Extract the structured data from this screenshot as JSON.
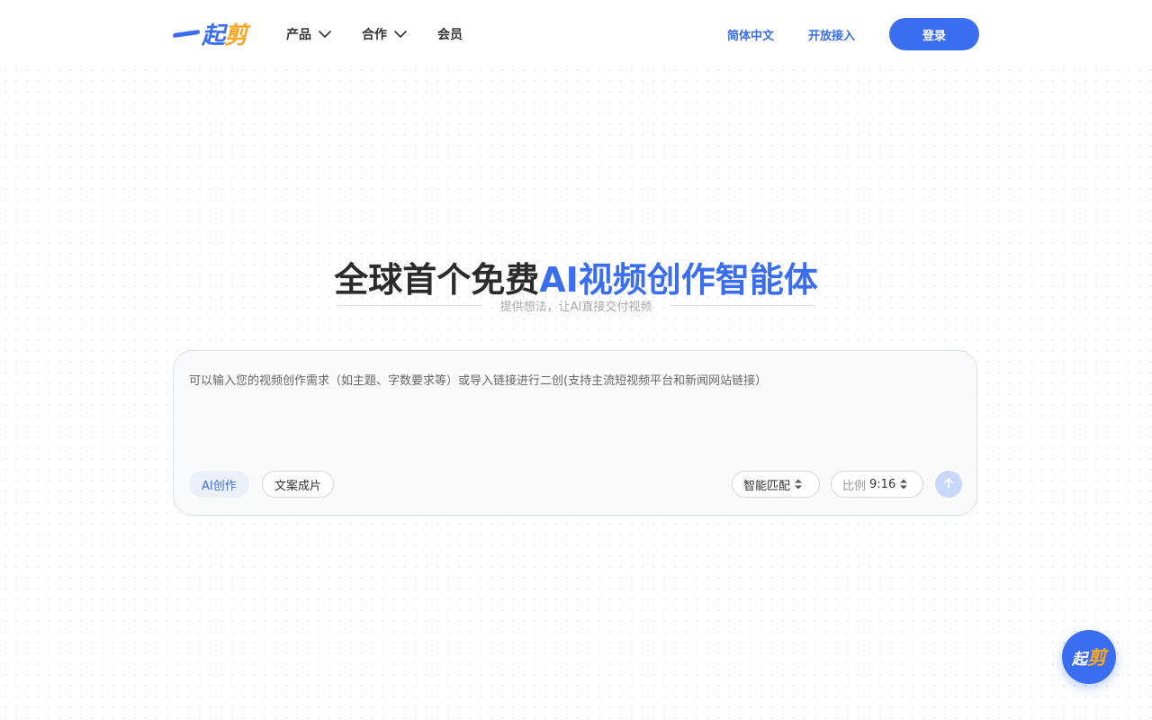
{
  "header": {
    "logo": {
      "part1": "起",
      "part2": "剪"
    },
    "nav": [
      {
        "label": "产品",
        "has_dropdown": true
      },
      {
        "label": "合作",
        "has_dropdown": true
      },
      {
        "label": "会员",
        "has_dropdown": false
      }
    ],
    "language_link": "简体中文",
    "open_access_link": "开放接入",
    "login_label": "登录"
  },
  "hero": {
    "title_plain": "全球首个免费",
    "title_accent": "AI视频创作智能体",
    "subtitle": "提供想法，让AI直接交付视频"
  },
  "prompt": {
    "placeholder": "可以输入您的视频创作需求（如主题、字数要求等）或导入链接进行二创(支持主流短视频平台和新闻网站链接）",
    "modes": [
      {
        "label": "AI创作",
        "active": true
      },
      {
        "label": "文案成片",
        "active": false
      }
    ],
    "match_select": "智能匹配",
    "ratio_label": "比例",
    "ratio_value": "9:16",
    "send_icon": "arrow-up-icon"
  },
  "float_button": {
    "part1": "起",
    "part2": "剪"
  },
  "colors": {
    "accent": "#3a6df0",
    "logo_orange": "#f5a623",
    "send_disabled": "#c8d8fa"
  }
}
